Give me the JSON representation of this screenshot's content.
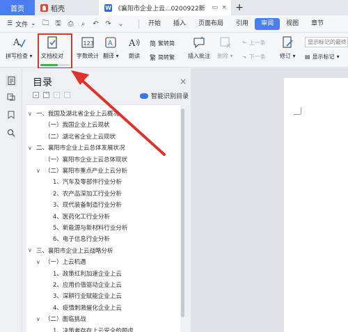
{
  "tabs": {
    "home": "首页",
    "app": "稻壳",
    "document": "《襄阳市企业上云...0200922新"
  },
  "menu": {
    "file": "文件",
    "items": [
      "开始",
      "插入",
      "页面布局",
      "引用",
      "审阅",
      "视图",
      "章节"
    ],
    "active": "审阅"
  },
  "ribbon": {
    "spell_check": "拼写检查",
    "doc_proofread": "文档校对",
    "word_count": "字数统计",
    "translate": "翻译",
    "read_aloud": "朗读",
    "trad_to_simp": "繁转简",
    "simp_to_trad": "简转繁",
    "insert_comment": "插入批注",
    "delete": "删除",
    "prev": "上一条",
    "next": "下一条",
    "track_changes": "修订",
    "show_markup_final": "显示标记的最终",
    "show_markup": "显示标记",
    "proofread_progress": 0.6
  },
  "toc": {
    "title": "目录",
    "smart_label": "智能识别目录",
    "items": [
      {
        "text": "一、我国及湖北省企业上云概况",
        "level": 0,
        "caret": "∨"
      },
      {
        "text": "（一）我国企业上云现状",
        "level": 1,
        "caret": ""
      },
      {
        "text": "（二）湖北省企业上云现状",
        "level": 1,
        "caret": ""
      },
      {
        "text": "二、襄阳市企业上云总体发展状况",
        "level": 0,
        "caret": "∨"
      },
      {
        "text": "（一）襄阳市企业上云总体现状",
        "level": 1,
        "caret": ""
      },
      {
        "text": "（二）襄阳市重点产业上云分析",
        "level": 1,
        "caret": "∨"
      },
      {
        "text": "1、汽车及零部件行业分析",
        "level": 2,
        "caret": ""
      },
      {
        "text": "2、农产品深加工行业分析",
        "level": 2,
        "caret": ""
      },
      {
        "text": "3、现代装备制造行业分析",
        "level": 2,
        "caret": ""
      },
      {
        "text": "4、医药化工行业分析",
        "level": 2,
        "caret": ""
      },
      {
        "text": "5、新能源与新材料行业分析",
        "level": 2,
        "caret": ""
      },
      {
        "text": "6、电子信息行业分析",
        "level": 2,
        "caret": ""
      },
      {
        "text": "三、襄阳市企业上云战略分析",
        "level": 0,
        "caret": "∨"
      },
      {
        "text": "（一）上云机遇",
        "level": 1,
        "caret": "∨"
      },
      {
        "text": "1、政策红利加速企业上云",
        "level": 2,
        "caret": ""
      },
      {
        "text": "2、应用价值驱动企业上云",
        "level": 2,
        "caret": ""
      },
      {
        "text": "3、深耕行业赋能企业上云",
        "level": 2,
        "caret": ""
      },
      {
        "text": "4、疫情刺激催化企业上云",
        "level": 2,
        "caret": ""
      },
      {
        "text": "（二）面临挑战",
        "level": 1,
        "caret": "∨"
      },
      {
        "text": "1、决策者存在上云安全的顾虑",
        "level": 2,
        "caret": ""
      }
    ]
  }
}
